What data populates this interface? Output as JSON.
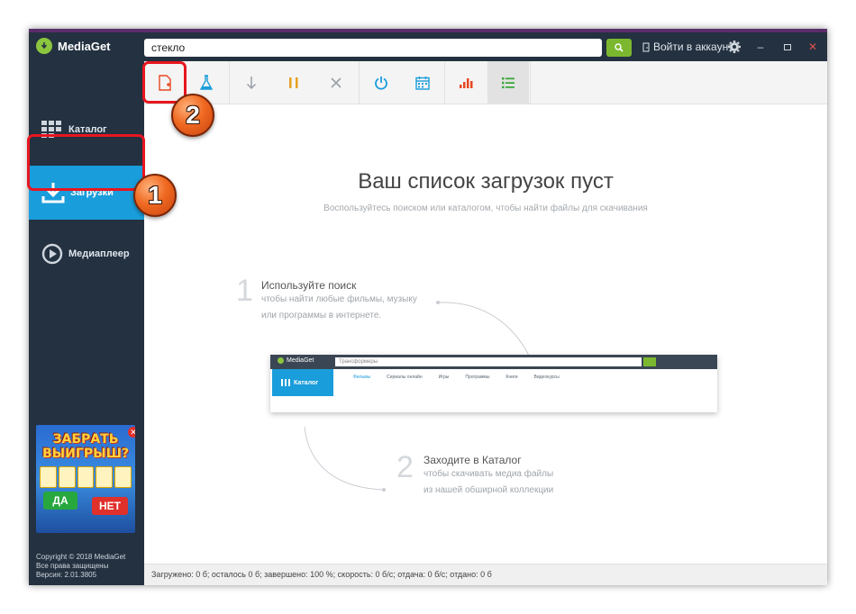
{
  "app": {
    "name": "MediaGet"
  },
  "search": {
    "value": "стекло"
  },
  "header": {
    "login_label": "Войти в аккаунт"
  },
  "sidebar": {
    "items": [
      {
        "label": "Каталог",
        "icon": "grid-icon"
      },
      {
        "label": "Загрузки",
        "icon": "download-icon",
        "active": true
      },
      {
        "label": "Медиаплеер",
        "icon": "play-icon"
      }
    ],
    "ad": {
      "title_line1": "ЗАБРАТЬ",
      "title_line2": "ВЫИГРЫШ?",
      "yes": "ДА",
      "no": "НЕТ"
    },
    "copyright": {
      "line1": "Copyright © 2018 MediaGet",
      "line2": "Все права защищены",
      "line3": "Версия: 2.01.3805"
    }
  },
  "toolbar": {
    "buttons": [
      "add-file-icon",
      "flask-icon",
      "download-arrow-icon",
      "pause-icon",
      "close-icon",
      "power-icon",
      "calendar-icon",
      "bar-chart-icon",
      "list-icon"
    ]
  },
  "main": {
    "title": "Ваш список загрузок пуст",
    "subtitle": "Воспользуйтесь поиском или каталогом, чтобы найти файлы для скачивания",
    "step1": {
      "num": "1",
      "heading": "Используйте поиск",
      "line1": "чтобы найти любые фильмы, музыку",
      "line2": "или программы в интернете."
    },
    "step2": {
      "num": "2",
      "heading": "Заходите в Каталог",
      "line1": "чтобы скачивать медиа файлы",
      "line2": "из нашей обширной коллекции"
    },
    "preview": {
      "logo": "MediaGet",
      "search": "Трансформеры",
      "catalog": "Каталог",
      "tabs": [
        "Фильмы",
        "Сериалы онлайн",
        "Игры",
        "Программы",
        "Книги",
        "Видеокурсы"
      ]
    }
  },
  "statusbar": {
    "text": "Загружено: 0 б; осталось 0 б; завершено: 100 %; скорость: 0 б/с; отдача: 0 б/с; отдано: 0 б"
  },
  "annotations": {
    "badge1": "1",
    "badge2": "2"
  },
  "colors": {
    "sidebar": "#243140",
    "accent": "#1a9ddb",
    "search_button": "#7cb82f",
    "annotation": "#e8151f"
  }
}
